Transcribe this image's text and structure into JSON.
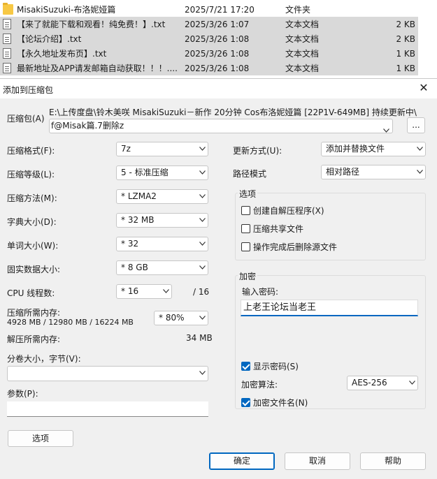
{
  "explorer": {
    "rows": [
      {
        "icon": "folder-icon",
        "name": "MisakiSuzuki-布洛妮娅篇",
        "date": "2025/7/21 17:20",
        "type": "文件夹",
        "size": ""
      },
      {
        "icon": "text-file-icon",
        "name": "【来了就能下载和观看！纯免费！】.txt",
        "date": "2025/3/26 1:07",
        "type": "文本文档",
        "size": "2 KB"
      },
      {
        "icon": "text-file-icon",
        "name": "【论坛介绍】.txt",
        "date": "2025/3/26 1:08",
        "type": "文本文档",
        "size": "2 KB"
      },
      {
        "icon": "text-file-icon",
        "name": "【永久地址发布页】.txt",
        "date": "2025/3/26 1:08",
        "type": "文本文档",
        "size": "1 KB"
      },
      {
        "icon": "text-file-icon",
        "name": "最新地址及APP请发邮箱自动获取！！！....",
        "date": "2025/3/26 1:08",
        "type": "文本文档",
        "size": "1 KB"
      }
    ]
  },
  "dialog": {
    "title": "添加到压缩包",
    "archive_label": "压缩包(A)",
    "archive_path_line1": "E:\\上传度盘\\铃木美咲 MisakiSuzuki－新作 20分钟 Cos布洛妮娅篇 [22P1V-649MB] 持续更新中\\",
    "archive_path_line2": "f@Misak篇.7删除z",
    "browse_label": "...",
    "left": {
      "format_label": "压缩格式(F):",
      "format_value": "7z",
      "level_label": "压缩等级(L):",
      "level_value": "5 - 标准压缩",
      "method_label": "压缩方法(M):",
      "method_value": "*  LZMA2",
      "dict_label": "字典大小(D):",
      "dict_value": "*  32 MB",
      "word_label": "单词大小(W):",
      "word_value": "*  32",
      "solid_label": "固实数据大小:",
      "solid_value": "*  8 GB",
      "cpu_label": "CPU 线程数:",
      "cpu_value": "*  16",
      "cpu_max": "/ 16",
      "mem_label": "压缩所需内存:",
      "mem_detail": "4928 MB / 12980 MB / 16224 MB",
      "mem_value": "*  80%",
      "decomp_label": "解压所需内存:",
      "decomp_value": "34 MB",
      "split_label": "分卷大小，字节(V):",
      "split_value": "",
      "params_label": "参数(P):",
      "params_value": "",
      "options_btn": "选项"
    },
    "right": {
      "update_label": "更新方式(U):",
      "update_value": "添加并替换文件",
      "path_label": "路径模式",
      "path_value": "相对路径",
      "options_group": "选项",
      "sfx_label": "创建自解压程序(X)",
      "sfx_checked": false,
      "shared_label": "压缩共享文件",
      "shared_checked": false,
      "delete_label": "操作完成后删除源文件",
      "delete_checked": false,
      "encryption_group": "加密",
      "pw_label": "输入密码:",
      "pw_value": "上老王论坛当老王",
      "show_pw_label": "显示密码(S)",
      "show_pw_checked": true,
      "algo_label": "加密算法:",
      "algo_value": "AES-256",
      "enc_names_label": "加密文件名(N)",
      "enc_names_checked": true
    },
    "buttons": {
      "ok": "确定",
      "cancel": "取消",
      "help": "帮助"
    }
  }
}
